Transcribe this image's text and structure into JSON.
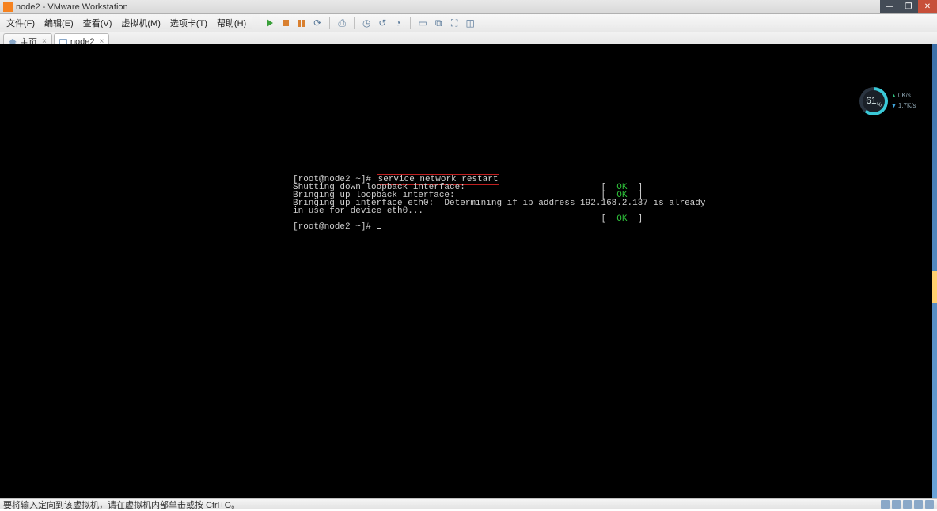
{
  "window": {
    "title": "node2 - VMware Workstation",
    "buttons": {
      "min": "—",
      "max": "❐",
      "close": "✕"
    }
  },
  "menu": {
    "file": "文件(F)",
    "edit": "编辑(E)",
    "view": "查看(V)",
    "vm": "虚拟机(M)",
    "tabs": "选项卡(T)",
    "help": "帮助(H)"
  },
  "toolbar": {
    "power_on": "play-icon",
    "power_off": "stop-icon",
    "suspend": "pause-icon",
    "restart": "restart-icon",
    "snapshot": "snapshot-icon",
    "clock": "clock-icon",
    "disk": "disk-icon",
    "net": "net-icon",
    "display": "display-icon",
    "fullscreen1": "screen-icon",
    "fullscreen2": "screen-icon",
    "unity": "unity-icon",
    "stretch": "stretch-icon"
  },
  "tabs": [
    {
      "label": "主页",
      "icon": "home",
      "active": false
    },
    {
      "label": "node2",
      "icon": "vm",
      "active": true
    }
  ],
  "terminal": {
    "prompt1": "[root@node2 ~]# ",
    "cmd": "service network restart",
    "line1a": "Shutting down loopback interface:                          [  ",
    "line1b": "OK",
    "line1c": "  ]",
    "line2a": "Bringing up loopback interface:                            [  ",
    "line2b": "OK",
    "line2c": "  ]",
    "line3": "Bringing up interface eth0:  Determining if ip address 192.168.2.137 is already",
    "line4": "in use for device eth0...",
    "line5a": "                                                           [  ",
    "line5b": "OK",
    "line5c": "  ]",
    "prompt2": "[root@node2 ~]# "
  },
  "gauge": {
    "value": "61",
    "unit": "%",
    "up": "0K/s",
    "down": "1.7K/s"
  },
  "status": {
    "hint": "要将输入定向到该虚拟机，请在虚拟机内部单击或按 Ctrl+G。"
  }
}
